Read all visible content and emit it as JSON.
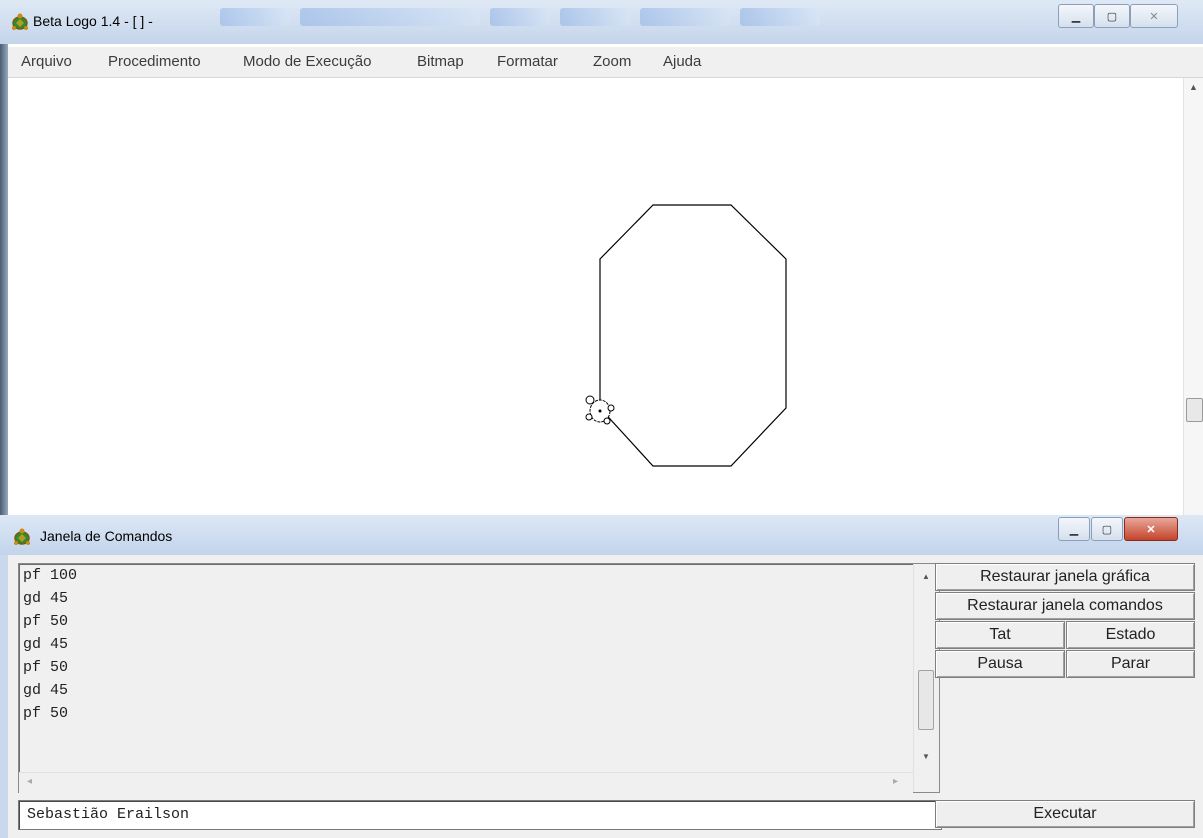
{
  "main_window": {
    "title": "Beta Logo 1.4 - [ ] -",
    "menu": [
      "Arquivo",
      "Procedimento",
      "Modo de Execução",
      "Bitmap",
      "Formatar",
      "Zoom",
      "Ajuda"
    ]
  },
  "command_window": {
    "title": "Janela de Comandos",
    "history": [
      "pf 100",
      "gd 45",
      "pf 50",
      "gd 45",
      "pf 50",
      "gd 45",
      "pf 50"
    ],
    "input_value": "Sebastião Erailson",
    "buttons": {
      "restore_graphics": "Restaurar janela gráfica",
      "restore_commands": "Restaurar janela comandos",
      "tat": "Tat",
      "estado": "Estado",
      "pausa": "Pausa",
      "parar": "Parar",
      "executar": "Executar"
    }
  },
  "icons": {
    "app": "turtle-icon",
    "minimize": "minimize-icon",
    "maximize": "maximize-icon",
    "close": "close-icon"
  }
}
